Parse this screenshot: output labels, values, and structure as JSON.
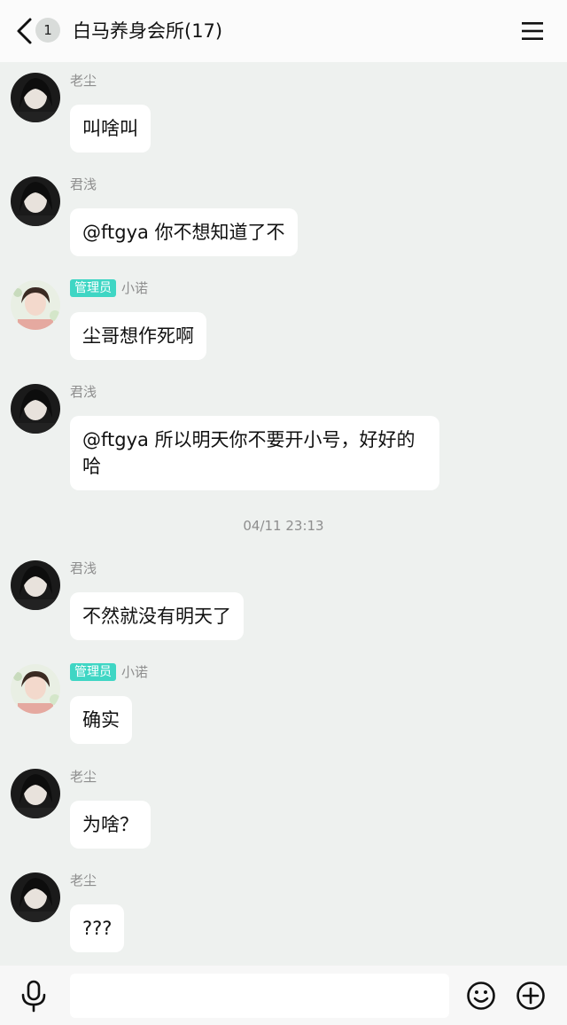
{
  "header": {
    "unread_count": "1",
    "title": "白马养身会所(17)"
  },
  "messages": [
    {
      "sender": "老尘",
      "admin": "",
      "text": "叫啥叫",
      "avatar": "avatar-laochen"
    },
    {
      "sender": "君浅",
      "admin": "",
      "text": "@ftgya 你不想知道了不",
      "avatar": "avatar-junqian"
    },
    {
      "sender": "小诺",
      "admin": "管理员",
      "text": "尘哥想作死啊",
      "avatar": "avatar-xiaonuo"
    },
    {
      "sender": "君浅",
      "admin": "",
      "text": "@ftgya 所以明天你不要开小号，好好的哈",
      "avatar": "avatar-junqian"
    },
    {
      "sender": "君浅",
      "admin": "",
      "text": "不然就没有明天了",
      "avatar": "avatar-junqian"
    },
    {
      "sender": "小诺",
      "admin": "管理员",
      "text": "确实",
      "avatar": "avatar-xiaonuo"
    },
    {
      "sender": "老尘",
      "admin": "",
      "text": "为啥？",
      "avatar": "avatar-laochen"
    },
    {
      "sender": "老尘",
      "admin": "",
      "text": "???",
      "avatar": "avatar-laochen"
    }
  ],
  "timestamp": "04/11 23:13",
  "input": {
    "value": "",
    "placeholder": ""
  },
  "icons": {
    "back": "chevron-left-icon",
    "menu": "hamburger-menu-icon",
    "mic": "microphone-icon",
    "emoji": "smiley-icon",
    "plus": "plus-circle-icon"
  },
  "colors": {
    "background": "#eef1ef",
    "bubble": "#ffffff",
    "admin_badge": "#3fd6c4"
  }
}
